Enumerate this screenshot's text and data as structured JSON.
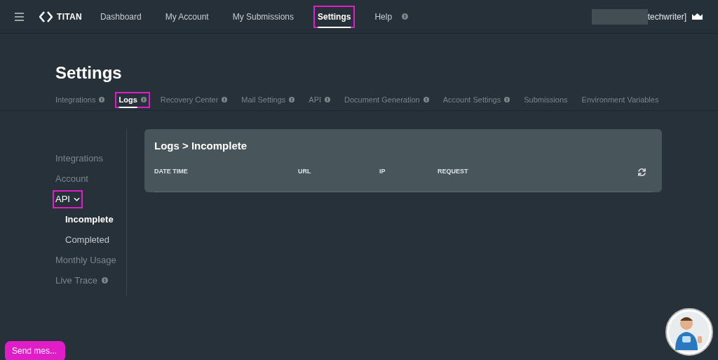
{
  "nav": {
    "brand": "TITAN",
    "items": [
      {
        "label": "Dashboard",
        "selected": false,
        "highlighted": false,
        "info": false
      },
      {
        "label": "My Account",
        "selected": false,
        "highlighted": false,
        "info": false
      },
      {
        "label": "My Submissions",
        "selected": false,
        "highlighted": false,
        "info": false
      },
      {
        "label": "Settings",
        "selected": true,
        "highlighted": true,
        "info": false
      },
      {
        "label": "Help",
        "selected": false,
        "highlighted": false,
        "info": true
      }
    ],
    "user": "techwriter]"
  },
  "page_title": "Settings",
  "tabs": [
    {
      "label": "Integrations",
      "info": true,
      "selected": false,
      "highlighted": false
    },
    {
      "label": "Logs",
      "info": true,
      "selected": true,
      "highlighted": true
    },
    {
      "label": "Recovery Center",
      "info": true,
      "selected": false,
      "highlighted": false
    },
    {
      "label": "Mail Settings",
      "info": true,
      "selected": false,
      "highlighted": false
    },
    {
      "label": "API",
      "info": true,
      "selected": false,
      "highlighted": false
    },
    {
      "label": "Document Generation",
      "info": true,
      "selected": false,
      "highlighted": false
    },
    {
      "label": "Account Settings",
      "info": true,
      "selected": false,
      "highlighted": false
    },
    {
      "label": "Submissions",
      "info": false,
      "selected": false,
      "highlighted": false
    },
    {
      "label": "Environment Variables",
      "info": false,
      "selected": false,
      "highlighted": false
    }
  ],
  "sidebar": {
    "items": [
      {
        "label": "Integrations",
        "selected": false,
        "info": false
      },
      {
        "label": "Account",
        "selected": false,
        "info": false
      },
      {
        "label": "API",
        "selected": true,
        "highlighted": true,
        "expanded": true,
        "info": false,
        "children": [
          {
            "label": "Incomplete",
            "selected": true
          },
          {
            "label": "Completed",
            "selected": false
          }
        ]
      },
      {
        "label": "Monthly Usage",
        "selected": false,
        "info": false
      },
      {
        "label": "Live Trace",
        "selected": false,
        "info": true
      }
    ]
  },
  "panel": {
    "title": "Logs > Incomplete",
    "columns": [
      "DATE TIME",
      "URL",
      "IP",
      "REQUEST"
    ]
  },
  "chat_button": "Send mes..."
}
